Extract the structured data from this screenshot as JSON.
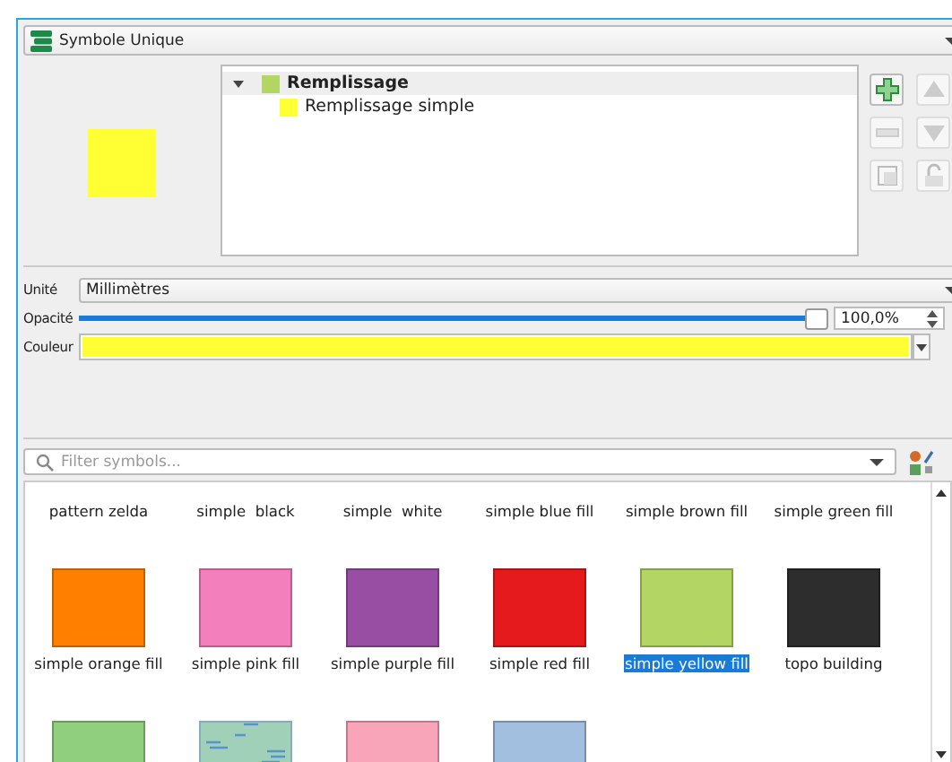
{
  "renderer": {
    "label": "Symbole Unique"
  },
  "preview": {
    "color": "#ffff33"
  },
  "layers": [
    {
      "label": "Remplissage",
      "color": "#b2d564",
      "expanded": true,
      "selected": true,
      "children": [
        {
          "label": "Remplissage simple",
          "color": "#ffff33",
          "selected": false
        }
      ]
    }
  ],
  "layer_buttons": [
    {
      "kind": "add",
      "disabled": false
    },
    {
      "kind": "up",
      "disabled": true
    },
    {
      "kind": "remove",
      "disabled": true
    },
    {
      "kind": "down",
      "disabled": true
    },
    {
      "kind": "duplicate",
      "disabled": true
    },
    {
      "kind": "lock",
      "disabled": true
    }
  ],
  "unit": {
    "label": "Unité",
    "value": "Millimètres"
  },
  "opacity": {
    "label": "Opacité",
    "level": 1.0,
    "reading": "100,0%"
  },
  "fill_color": {
    "label": "Couleur",
    "color": "#ffff33"
  },
  "filter": {
    "placeholder": "Filter symbols..."
  },
  "symbols": [
    {
      "label": "pattern zelda",
      "selected": false
    },
    {
      "label": "simple  black",
      "selected": false
    },
    {
      "label": "simple  white",
      "selected": false
    },
    {
      "label": "simple blue fill",
      "selected": false
    },
    {
      "label": "simple brown fill",
      "selected": false
    },
    {
      "label": "simple green fill",
      "selected": false
    },
    {
      "kind": "plain",
      "color": "#ff8000",
      "label": "simple orange fill",
      "selected": false
    },
    {
      "kind": "plain",
      "color": "#f47fbd",
      "label": "simple pink fill",
      "selected": false
    },
    {
      "kind": "plain",
      "color": "#984ea3",
      "label": "simple purple fill",
      "selected": false
    },
    {
      "kind": "plain",
      "color": "#e41a1c",
      "label": "simple red fill",
      "selected": false
    },
    {
      "kind": "plain",
      "color": "#b2d564",
      "label": "simple yellow fill",
      "selected": true
    },
    {
      "kind": "plain",
      "color": "#2d2d2d",
      "label": "topo building",
      "selected": false
    },
    {
      "kind": "plain",
      "color": "#8fcf7d"
    },
    {
      "kind": "pattern",
      "color": "#a0d0b8"
    },
    {
      "kind": "plain",
      "color": "#f9a5b9"
    },
    {
      "kind": "plain",
      "color": "#a3bfdf"
    }
  ]
}
